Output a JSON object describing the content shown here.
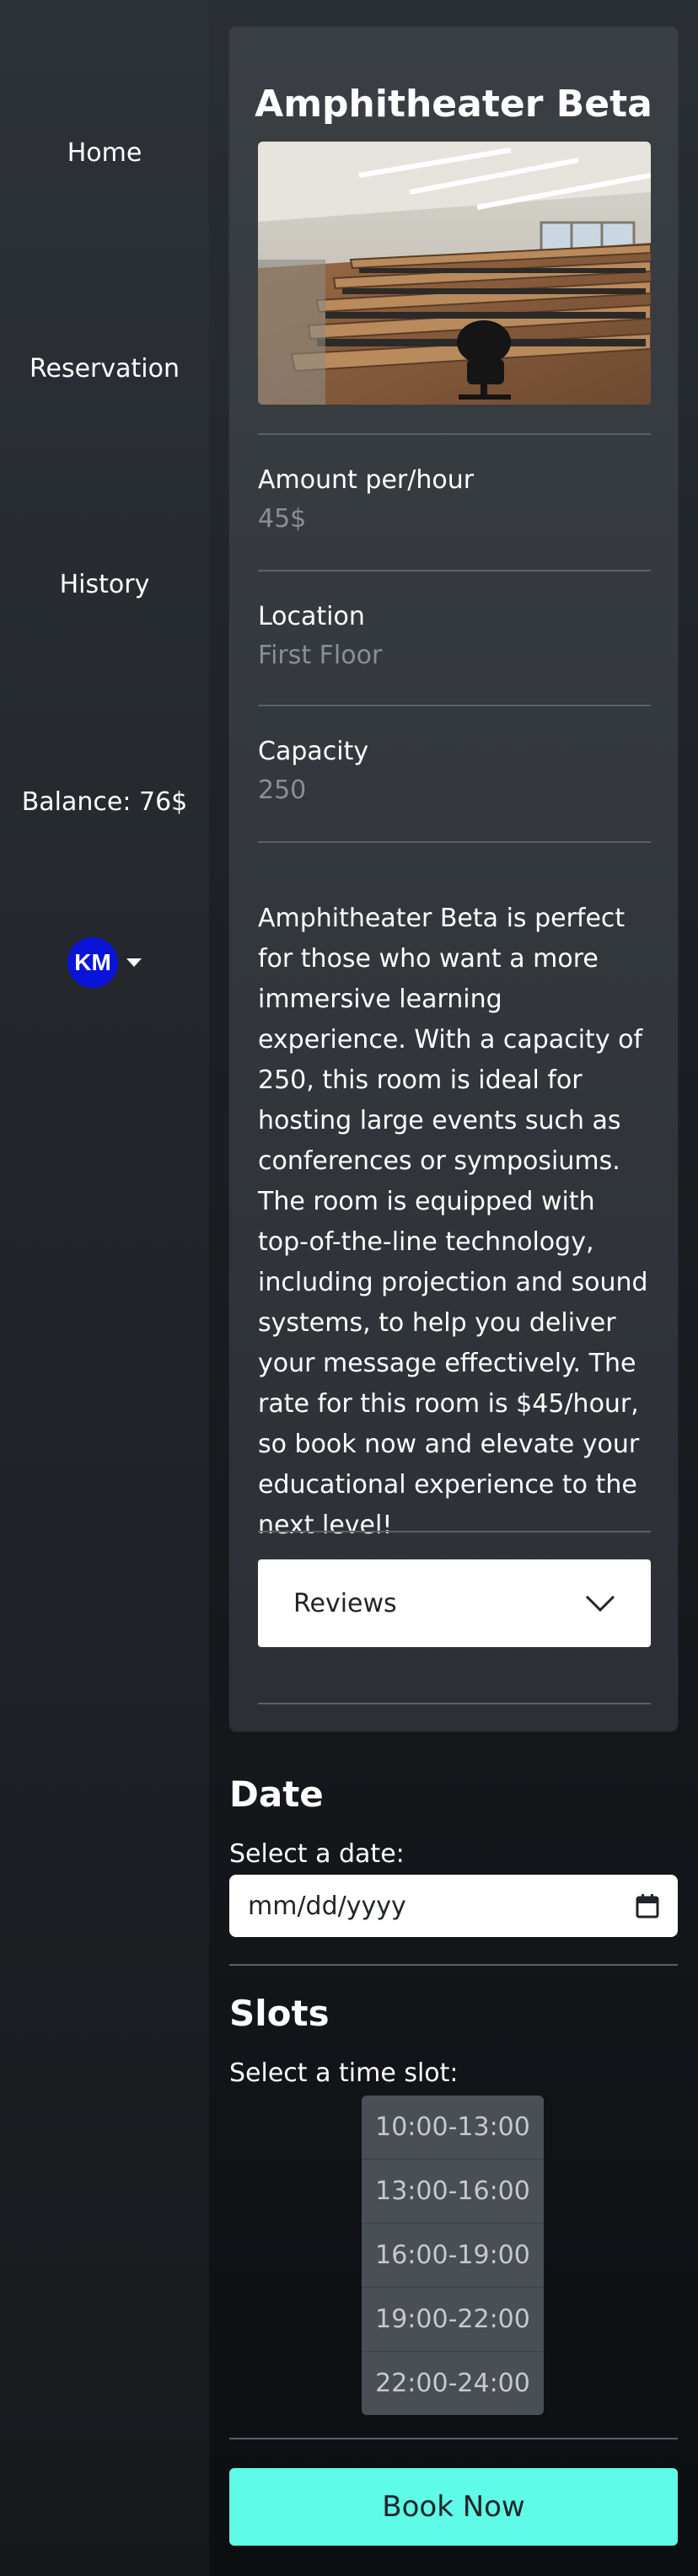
{
  "sidebar": {
    "home": "Home",
    "reservation": "Reservation",
    "history": "History",
    "balance": "Balance: 76$",
    "user_initials": "KM"
  },
  "room": {
    "title": "Amphitheater Beta",
    "amount_label": "Amount per/hour",
    "amount_value": "45$",
    "location_label": "Location",
    "location_value": "First Floor",
    "capacity_label": "Capacity",
    "capacity_value": "250",
    "description": "Amphitheater Beta is perfect for those who want a more immersive learning experience. With a capacity of 250, this room is ideal for hosting large events such as conferences or symposiums. The room is equipped with top-of-the-line technology, including projection and sound systems, to help you deliver your message effectively. The rate for this room is $45/hour, so book now and elevate your educational experience to the next level!",
    "reviews_label": "Reviews"
  },
  "date": {
    "title": "Date",
    "label": "Select a date:",
    "placeholder": "mm/dd/yyyy"
  },
  "slots": {
    "title": "Slots",
    "label": "Select a time slot:",
    "items": [
      "10:00-13:00",
      "13:00-16:00",
      "16:00-19:00",
      "19:00-22:00",
      "22:00-24:00"
    ]
  },
  "actions": {
    "book_label": "Book Now"
  },
  "colors": {
    "accent": "#5dfbe8",
    "avatar": "#0a14d8"
  }
}
